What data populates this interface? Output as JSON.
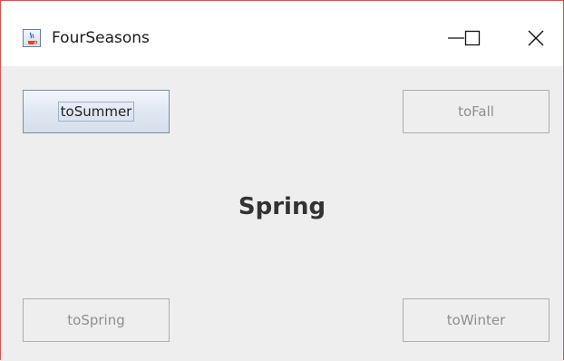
{
  "window": {
    "title": "FourSeasons",
    "app_icon": "java-coffee-icon",
    "controls": [
      "minimize-icon",
      "maximize-icon",
      "close-icon"
    ]
  },
  "buttons": {
    "to_summer": {
      "label": "toSummer",
      "enabled": true,
      "focused": true
    },
    "to_fall": {
      "label": "toFall",
      "enabled": false
    },
    "to_spring": {
      "label": "toSpring",
      "enabled": false
    },
    "to_winter": {
      "label": "toWinter",
      "enabled": false
    }
  },
  "season_label": "Spring",
  "colors": {
    "titlebar_bg": "#ffffff",
    "content_bg": "#eeeeee",
    "window_border": "#d9534f",
    "disabled_text": "#8f8f8f"
  }
}
